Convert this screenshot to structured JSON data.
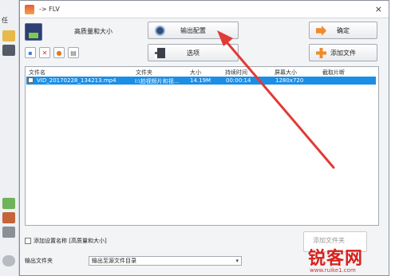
{
  "background": {
    "labels": [
      "任"
    ],
    "icons": [
      "folder-icon",
      "film-icon",
      "music-icon",
      "toolbox-icon",
      "settings-icon",
      "disc-icon"
    ]
  },
  "dialog": {
    "title": "-> FLV",
    "close": "×"
  },
  "preset": {
    "name": "高质量和大小"
  },
  "buttons": {
    "output_config": "输出配置",
    "confirm": "确定",
    "options": "选项",
    "add_file": "添加文件",
    "add_folder": "添加文件夹"
  },
  "table": {
    "headers": [
      "文件名",
      "文件夹",
      "大小",
      "持续时间",
      "屏幕大小",
      "截取片断"
    ],
    "rows": [
      {
        "filename": "VID_20170228_134213.mp4",
        "folder": "I:\\拍视频片和视...",
        "size": "14.19M",
        "duration": "00:00:14",
        "screen": "1280x720",
        "clip": ""
      }
    ]
  },
  "settings": {
    "add_setting_name": "添加设置名称 [高质量和大小]"
  },
  "output": {
    "label": "输出文件夹",
    "selected": "输出至源文件目录",
    "chevron": "▾"
  },
  "watermark": {
    "logo": "锐客网",
    "url": "www.ruike1.com"
  },
  "colors": {
    "selection": "#1b8ee6",
    "arrow": "#e03b36",
    "watermark": "#d9211c"
  }
}
